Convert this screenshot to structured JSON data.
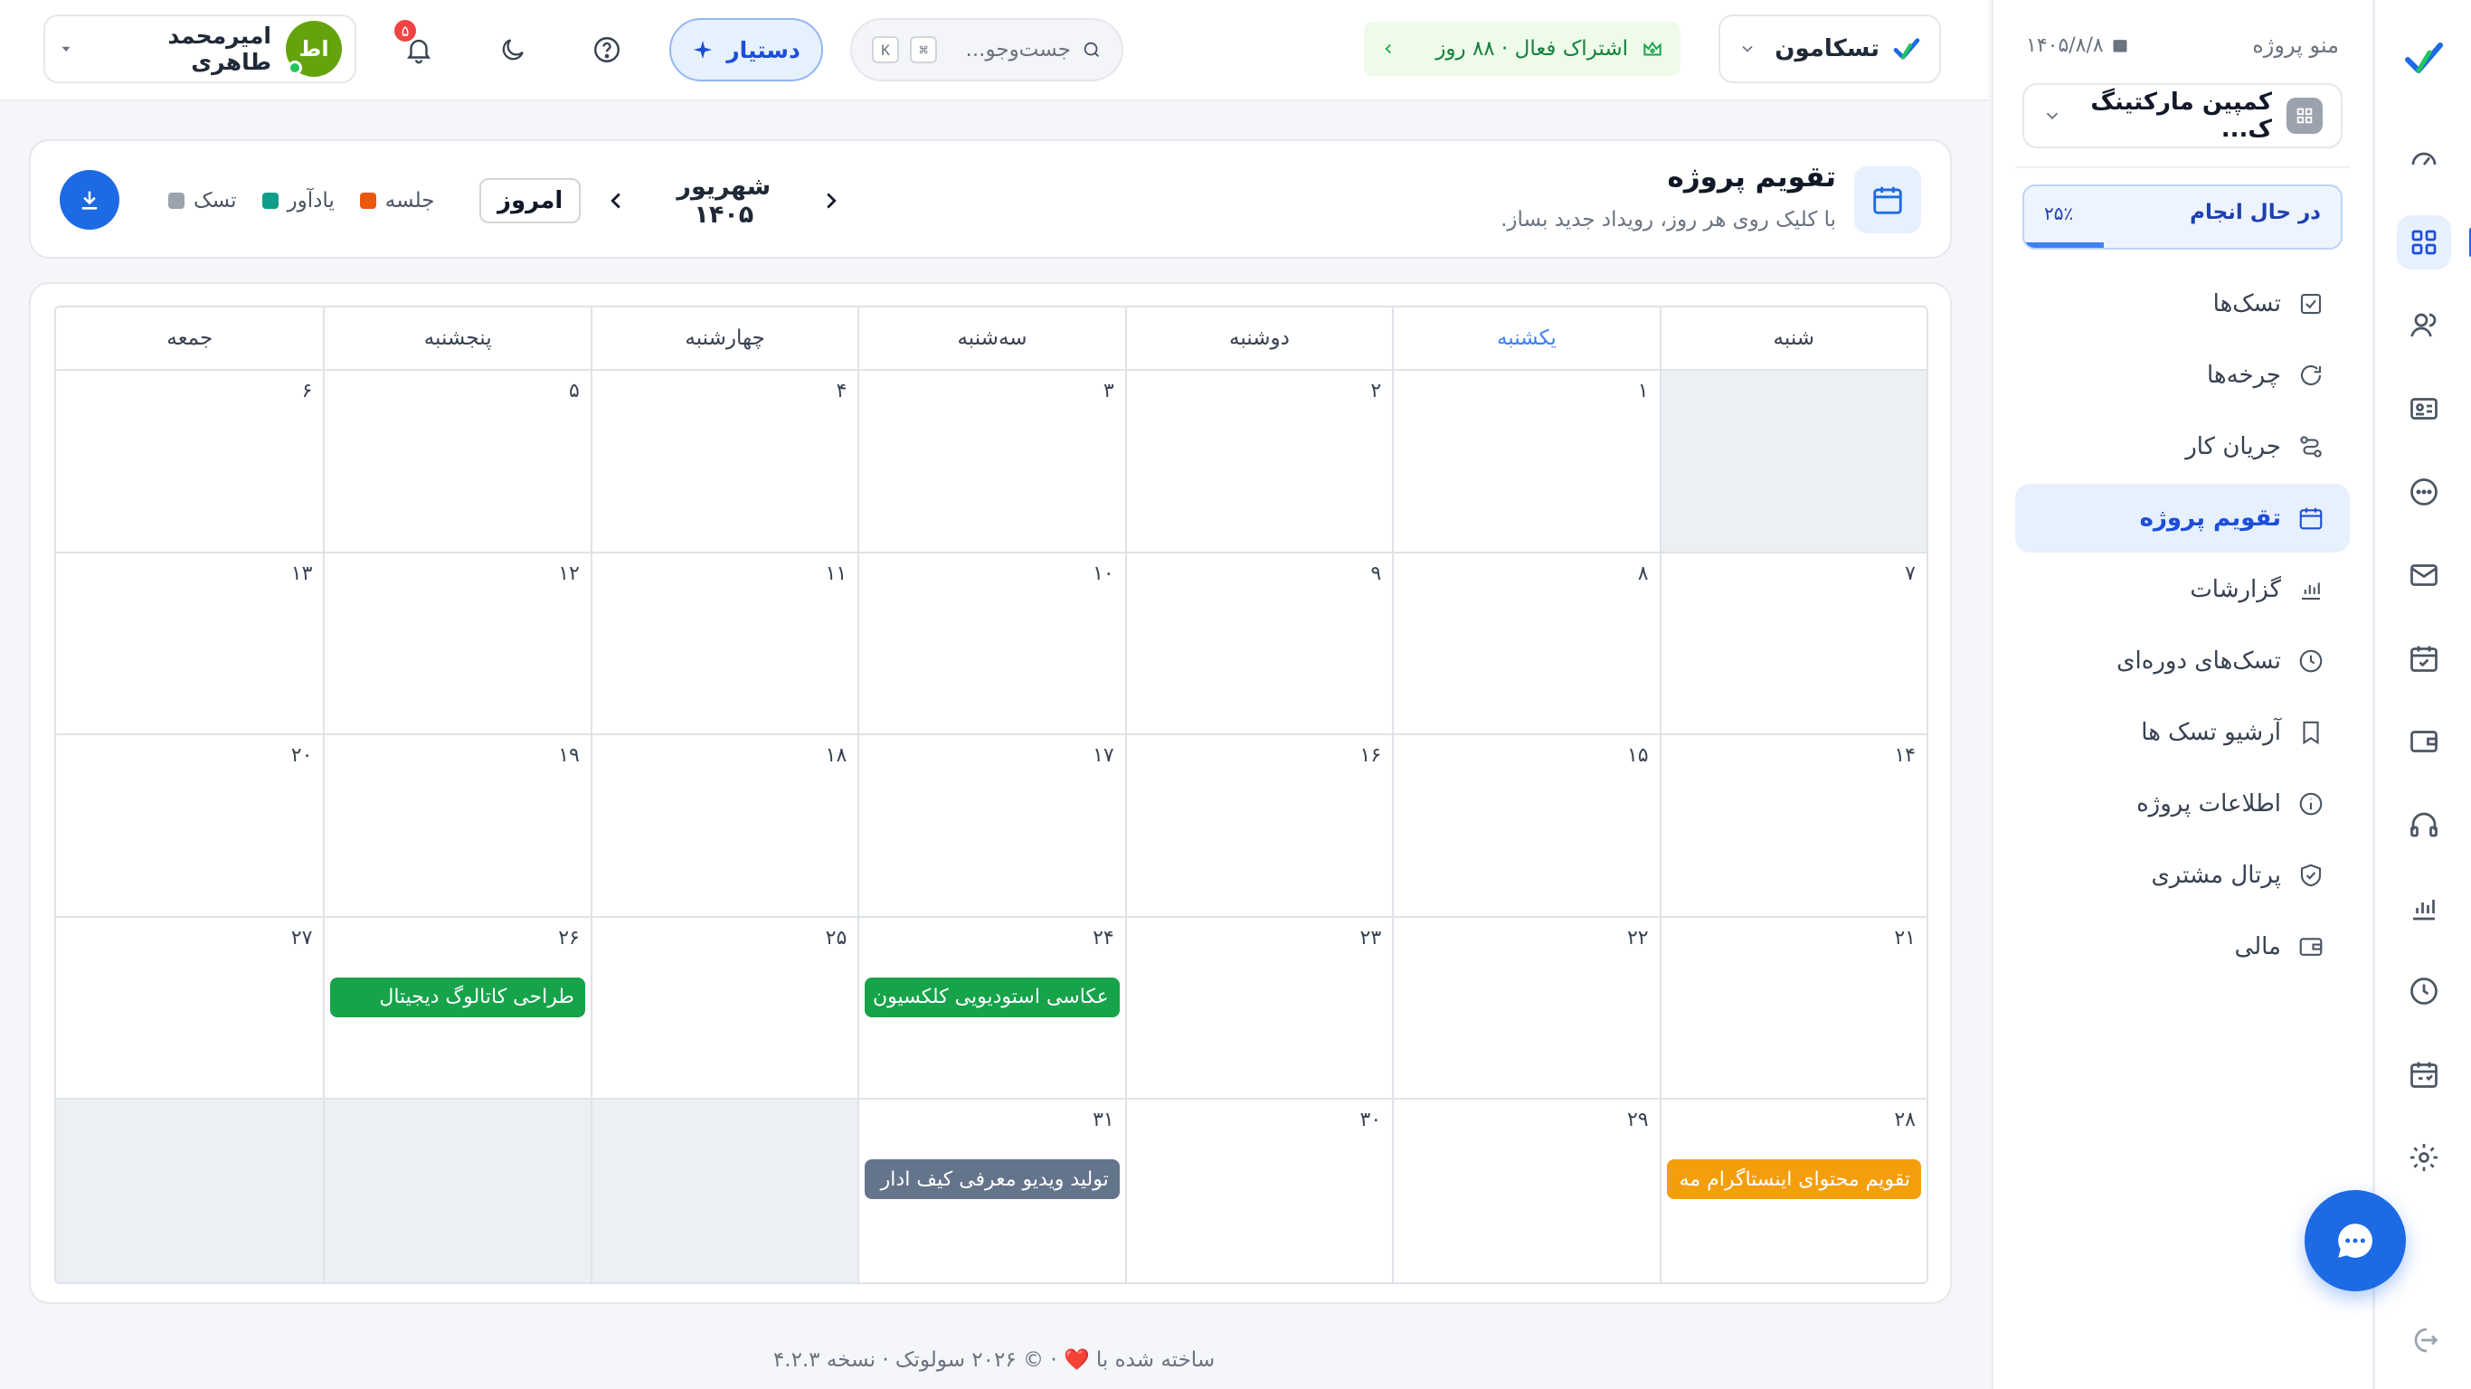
{
  "header": {
    "workspace": "تسکامون",
    "subscription": "اشتراک فعال · ۸۸ روز",
    "search_placeholder": "جست‌وجو...",
    "search_kbd_cmd": "⌘",
    "search_kbd_key": "K",
    "assistant_label": "دستیار",
    "notifications_count": "۵",
    "user_name": "امیرمحمد طاهری",
    "user_initials": "اط"
  },
  "project_sidebar": {
    "title": "منو پروژه",
    "date": "۱۴۰۵/۸/۸",
    "project_name": "کمپین مارکتینگ ک...",
    "status_label": "در حال انجام",
    "status_progress_text": "۲۵٪",
    "status_progress": 0.25,
    "nav": [
      {
        "label": "تسک‌ها",
        "icon": "check-square-icon"
      },
      {
        "label": "چرخه‌ها",
        "icon": "refresh-icon"
      },
      {
        "label": "جریان کار",
        "icon": "workflow-icon"
      },
      {
        "label": "تقویم پروژه",
        "icon": "calendar-icon",
        "active": true
      },
      {
        "label": "گزارشات",
        "icon": "bar-chart-icon"
      },
      {
        "label": "تسک‌های دوره‌ای",
        "icon": "clock-icon"
      },
      {
        "label": "آرشیو تسک ها",
        "icon": "bookmark-icon"
      },
      {
        "label": "اطلاعات پروژه",
        "icon": "info-icon"
      },
      {
        "label": "پرتال مشتری",
        "icon": "shield-check-icon"
      },
      {
        "label": "مالی",
        "icon": "wallet-icon"
      }
    ]
  },
  "page": {
    "title": "تقویم پروژه",
    "subtitle": "با کلیک روی هر روز، رویداد جدید بساز.",
    "month_label": "شهریور ۱۴۰۵",
    "today_label": "امروز",
    "legend": [
      {
        "label": "جلسه",
        "color": "#ea580c"
      },
      {
        "label": "یادآور",
        "color": "#0f9d8a"
      },
      {
        "label": "تسک",
        "color": "#9ca3af"
      }
    ]
  },
  "calendar": {
    "weekdays": [
      "شنبه",
      "یکشنبه",
      "دوشنبه",
      "سه‌شنبه",
      "چهارشنبه",
      "پنجشنبه",
      "جمعه"
    ],
    "today_weekday_index": 1,
    "weeks": [
      [
        null,
        "۱",
        "۲",
        "۳",
        "۴",
        "۵",
        "۶"
      ],
      [
        "۷",
        "۸",
        "۹",
        "۱۰",
        "۱۱",
        "۱۲",
        "۱۳"
      ],
      [
        "۱۴",
        "۱۵",
        "۱۶",
        "۱۷",
        "۱۸",
        "۱۹",
        "۲۰"
      ],
      [
        "۲۱",
        "۲۲",
        "۲۳",
        "۲۴",
        "۲۵",
        "۲۶",
        "۲۷"
      ],
      [
        "۲۸",
        "۲۹",
        "۳۰",
        "۳۱",
        null,
        null,
        null
      ]
    ],
    "events": [
      {
        "week": 3,
        "day": 3,
        "title": "عکاسی استودیویی کلکسیون",
        "color": "#16a34a"
      },
      {
        "week": 3,
        "day": 5,
        "title": "طراحی کاتالوگ دیجیتال",
        "color": "#16a34a"
      },
      {
        "week": 4,
        "day": 0,
        "title": "تقویم محتوای اینستاگرام مه",
        "color": "#f59e0b"
      },
      {
        "week": 4,
        "day": 3,
        "title": "تولید ویدیو معرفی کیف ادار",
        "color": "#64748b"
      }
    ]
  },
  "footer": "ساخته شده با ❤️ · © ۲۰۲۶ سولوتک · نسخه ۴.۲.۳",
  "colors": {
    "accent": "#1d6ae5",
    "active_bg": "#e7f0fd"
  }
}
